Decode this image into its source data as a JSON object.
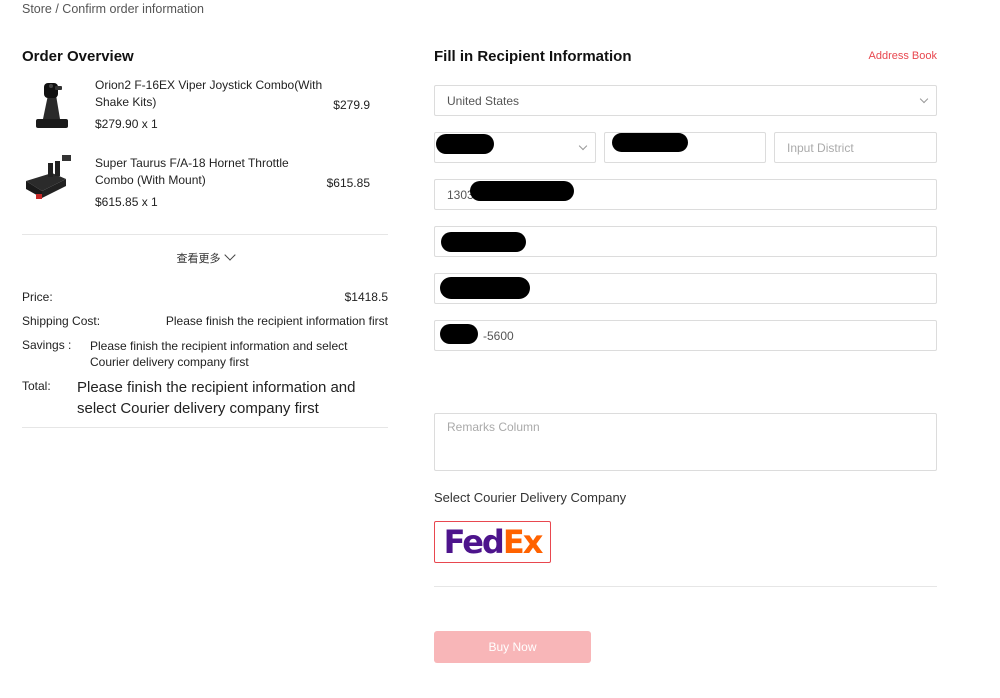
{
  "breadcrumb": "Store / Confirm order information",
  "order": {
    "title": "Order Overview",
    "items": [
      {
        "name": "Orion2 F-16EX Viper Joystick Combo(With Shake Kits)",
        "price": "$279.9",
        "qty": "$279.90 x 1"
      },
      {
        "name": "Super Taurus F/A-18 Hornet Throttle Combo (With Mount)",
        "price": "$615.85",
        "qty": "$615.85 x 1"
      }
    ],
    "see_more": "查看更多"
  },
  "summary": {
    "price_label": "Price:",
    "price_value": "$1418.5",
    "shipping_label": "Shipping Cost:",
    "shipping_value": "Please finish the recipient information first",
    "savings_label": "Savings :",
    "savings_value": "Please finish the recipient information and select Courier delivery company first",
    "total_label": "Total:",
    "total_value": "Please finish the recipient information and select Courier delivery company first"
  },
  "recipient": {
    "title": "Fill in Recipient Information",
    "address_book": "Address Book",
    "country": "United States",
    "district_placeholder": "Input District",
    "phone_prefix": "1303",
    "postal_suffix": "-5600",
    "remarks_placeholder": "Remarks Column"
  },
  "courier": {
    "title": "Select Courier Delivery Company",
    "fedex_fed": "Fed",
    "fedex_ex": "Ex"
  },
  "buy_button": "Buy Now",
  "colors": {
    "accent": "#e8474f",
    "button_disabled": "#f8b6b8",
    "fedex_purple": "#4d148c",
    "fedex_orange": "#ff6200"
  }
}
